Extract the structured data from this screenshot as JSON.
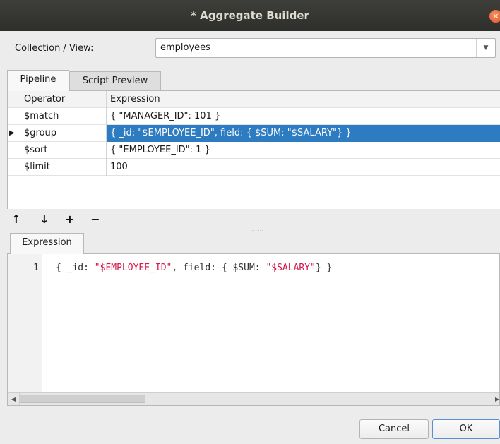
{
  "window": {
    "title": "* Aggregate Builder",
    "close_glyph": "×"
  },
  "collection": {
    "label": "Collection / View:",
    "value": "employees",
    "arrow": "▼"
  },
  "tabs": [
    {
      "label": "Pipeline",
      "active": true
    },
    {
      "label": "Script Preview",
      "active": false
    }
  ],
  "pipeline": {
    "columns": [
      "Operator",
      "Expression"
    ],
    "selected_indicator": "▶",
    "rows": [
      {
        "operator": "$match",
        "expression": "{ \"MANAGER_ID\": 101 }",
        "selected": false
      },
      {
        "operator": "$group",
        "expression": "{ _id: \"$EMPLOYEE_ID\", field: { $SUM: \"$SALARY\"} }",
        "selected": true
      },
      {
        "operator": "$sort",
        "expression": "{ \"EMPLOYEE_ID\": 1 }",
        "selected": false
      },
      {
        "operator": "$limit",
        "expression": "100",
        "selected": false
      }
    ]
  },
  "toolbar": {
    "move_up": "↑",
    "move_down": "↓",
    "add": "+",
    "remove": "−",
    "splitter": "……"
  },
  "expression_editor": {
    "tab_label": "Expression",
    "line_number": "1",
    "code_parts": {
      "p1": "{ _id: ",
      "s1": "\"$EMPLOYEE_ID\"",
      "p2": ", field: { $SUM: ",
      "s2": "\"$SALARY\"",
      "p3": "} }"
    },
    "scroll_left": "◀",
    "scroll_right": "▶"
  },
  "buttons": {
    "cancel": "Cancel",
    "ok": "OK"
  },
  "colors": {
    "selection": "#2d7cc1",
    "string_literal": "#d5174a",
    "titlebar": "#3a3a37"
  }
}
